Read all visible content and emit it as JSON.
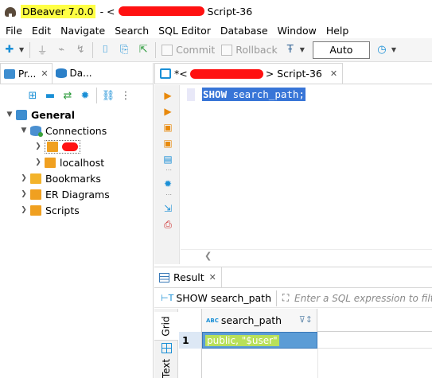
{
  "window": {
    "app_title": "DBeaver 7.0.0",
    "separator": "- <",
    "file_title": "Script-36"
  },
  "menu": [
    "File",
    "Edit",
    "Navigate",
    "Search",
    "SQL Editor",
    "Database",
    "Window",
    "Help"
  ],
  "menu_mnemonics": [
    "F",
    "E",
    "N",
    "S",
    "Q",
    "D",
    "W",
    "H"
  ],
  "toolbar": {
    "commit_label": "Commit",
    "rollback_label": "Rollback",
    "tx_mode_value": "Auto"
  },
  "left_panel": {
    "tabs": [
      {
        "label": "Pr...",
        "close": "✕"
      },
      {
        "label": "Da...",
        "close": "✕"
      }
    ],
    "tree": {
      "root": "General",
      "connections": "Connections",
      "connection_localhost": "localhost",
      "bookmarks": "Bookmarks",
      "er_diagrams": "ER Diagrams",
      "scripts": "Scripts"
    }
  },
  "editor": {
    "tab_prefix": "*<",
    "tab_suffix": "> Script-36",
    "tab_close": "✕",
    "sql_keyword": "SHOW",
    "sql_rest": " search_path;"
  },
  "result": {
    "tab_label": "Result",
    "tab_close": "✕",
    "query_label": "SHOW search_path",
    "filter_placeholder": "Enter a SQL expression to filter results (use Ctrl+Space)",
    "side_tabs": {
      "grid": "Grid",
      "text": "Text"
    },
    "columns": [
      {
        "name": "search_path"
      }
    ],
    "rows": [
      {
        "num": "1",
        "cells": [
          "public, \"$user\""
        ]
      }
    ]
  },
  "colors": {
    "accent": "#1a8fd6",
    "selection": "#3875d7",
    "title_highlight": "#ffff44",
    "redaction": "#ff1111",
    "cell_highlight": "#b8e05a"
  }
}
